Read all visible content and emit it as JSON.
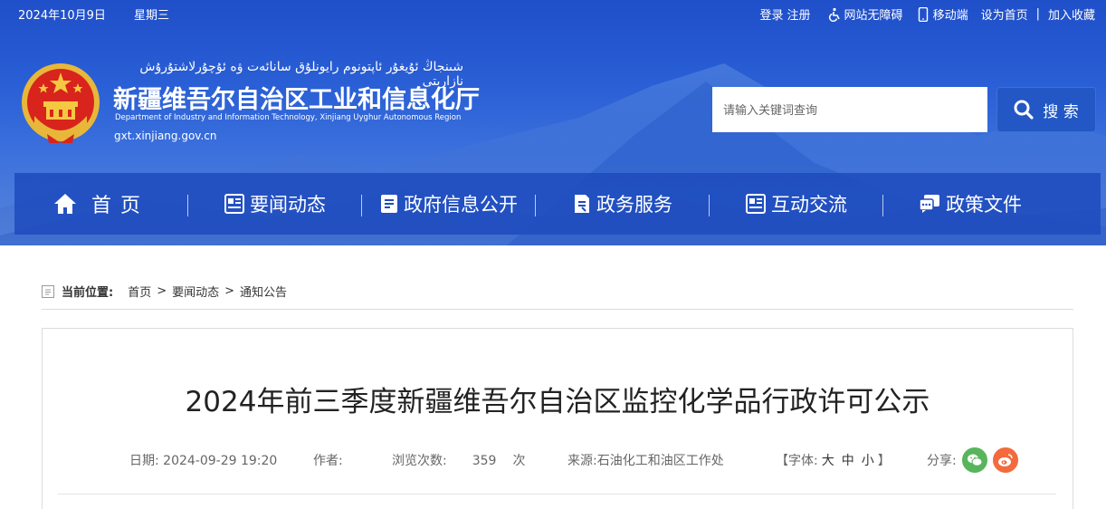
{
  "topbar": {
    "date": "2024年10月9日",
    "weekday": "星期三",
    "login": "登录",
    "register": "注册",
    "accessibility": "网站无障碍",
    "mobile": "移动端",
    "set_home": "设为首页",
    "divider": "|",
    "favorite": "加入收藏"
  },
  "site": {
    "title_uyghur": "شىنجاڭ ئۇيغۇر ئاپتونوم رايونلۇق سانائەت ۋە ئۇچۇرلاشتۇرۇش نازارىتى",
    "title_cn": "新疆维吾尔自治区工业和信息化厅",
    "title_en": "Department of Industry and Information Technology, Xinjiang Uyghur Autonomous Region",
    "domain": "gxt.xinjiang.gov.cn"
  },
  "search": {
    "placeholder": "请输入关键词查询",
    "button": "搜 索"
  },
  "nav": [
    {
      "label": "首页",
      "icon": "home-icon"
    },
    {
      "label": "要闻动态",
      "icon": "news-icon"
    },
    {
      "label": "政府信息公开",
      "icon": "info-icon"
    },
    {
      "label": "政务服务",
      "icon": "service-icon"
    },
    {
      "label": "互动交流",
      "icon": "interaction-icon"
    },
    {
      "label": "政策文件",
      "icon": "policy-icon"
    }
  ],
  "breadcrumb": {
    "label": "当前位置:",
    "items": [
      "首页",
      "要闻动态",
      "通知公告"
    ],
    "sep": ">"
  },
  "article": {
    "title": "2024年前三季度新疆维吾尔自治区监控化学品行政许可公示",
    "date_label": "日期:",
    "date": "2024-09-29 19:20",
    "author_label": "作者:",
    "views_label": "浏览次数:",
    "views": "359",
    "views_unit": "次",
    "source_label": "来源:",
    "source": "石油化工和油区工作处",
    "font_open": "【字体:",
    "font_large": "大",
    "font_medium": "中",
    "font_small": "小",
    "font_close": "】",
    "share_label": "分享:"
  },
  "colors": {
    "header_blue": "#2a5fd6",
    "nav_blue": "#1f4cbe",
    "wechat_green": "#58b55c",
    "weibo_orange": "#f26a3d"
  }
}
